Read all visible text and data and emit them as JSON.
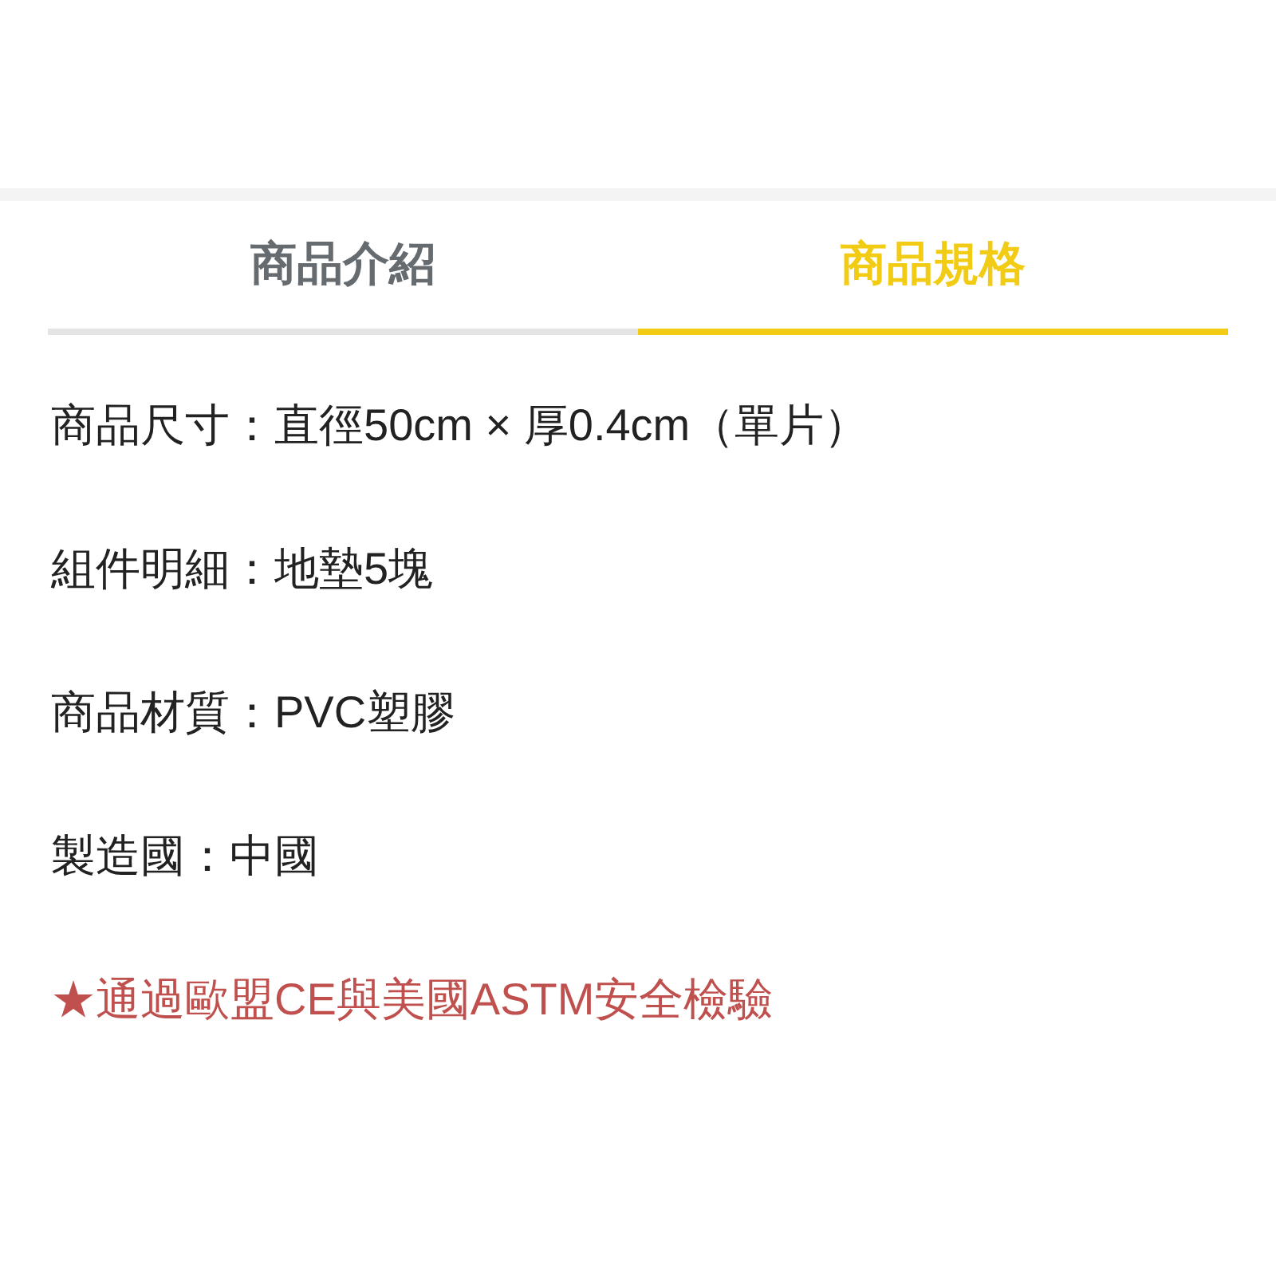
{
  "tabs": [
    {
      "label": "商品介紹",
      "selected": false
    },
    {
      "label": "商品規格",
      "selected": true
    }
  ],
  "specs": [
    {
      "kind": "plain",
      "text": "商品尺寸：直徑50cm × 厚0.4cm（單片）"
    },
    {
      "kind": "plain",
      "text": "組件明細：地墊5塊"
    },
    {
      "kind": "plain",
      "text": "商品材質：PVC塑膠"
    },
    {
      "kind": "plain",
      "text": "製造國：中國"
    },
    {
      "kind": "highlight",
      "text": "★通過歐盟CE與美國ASTM安全檢驗"
    }
  ]
}
